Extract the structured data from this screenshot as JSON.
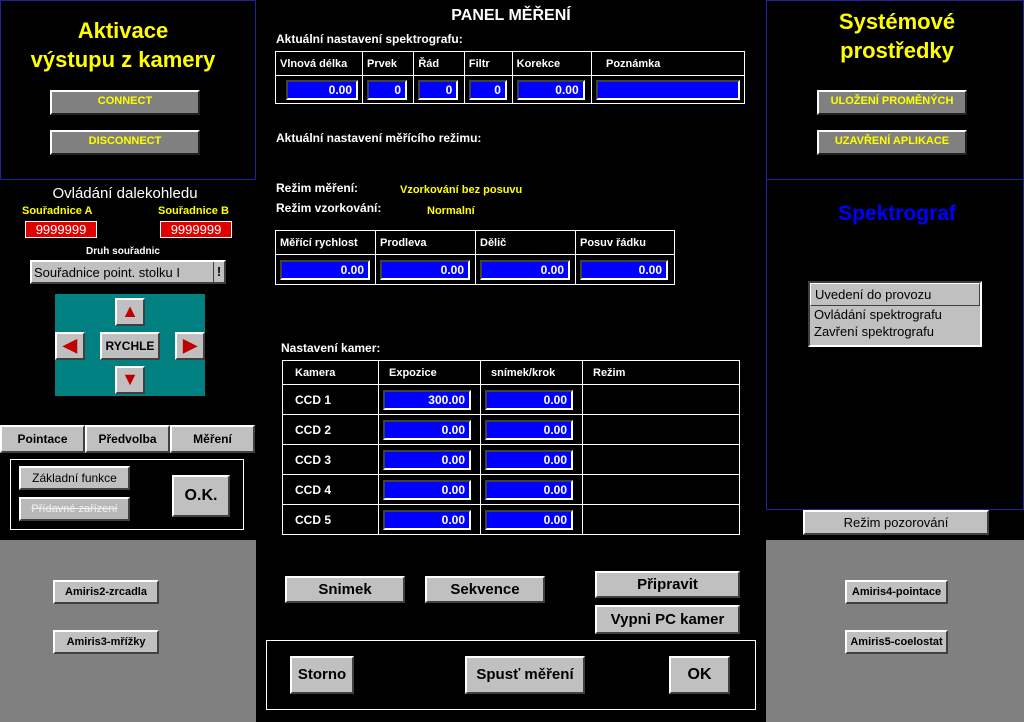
{
  "camera_activation": {
    "title_line1": "Aktivace",
    "title_line2": "výstupu z kamery",
    "connect": "CONNECT",
    "disconnect": "DISCONNECT"
  },
  "telescope": {
    "title": "Ovládání dalekohledu",
    "coord_a_label": "Souřadnice A",
    "coord_b_label": "Souřadnice B",
    "coord_a_value": "9999999",
    "coord_b_value": "9999999",
    "coord_type_label": "Druh souřadnic",
    "coord_type_value": "Souřadnice point. stolku I",
    "speed_label": "RYCHLE",
    "tabs": [
      "Pointace",
      "Předvolba",
      "Měření"
    ],
    "basic_functions": "Základní funkce",
    "extra_devices": "Přídavné zařízení",
    "ok": "O.K."
  },
  "panel": {
    "title": "PANEL MĚŘENÍ",
    "spectrograph_settings_label": "Aktuální nastavení spektrografu:",
    "spectro_headers": [
      "Vlnová délka",
      "Prvek",
      "Řád",
      "Filtr",
      "Korekce",
      "Poznámka"
    ],
    "spectro_values": [
      "0.00",
      "0",
      "0",
      "0",
      "0.00",
      ""
    ],
    "measure_mode_settings_label": "Aktuální nastavení měřícího režimu:",
    "measure_mode_label": "Režim měření:",
    "measure_mode_value": "Vzorkování bez posuvu",
    "sampling_mode_label": "Režim vzorkování:",
    "sampling_mode_value": "Normalní",
    "mode_headers": [
      "Měřící rychlost",
      "Prodleva",
      "Dělič",
      "Posuv řádku"
    ],
    "mode_values": [
      "0.00",
      "0.00",
      "0.00",
      "0.00"
    ],
    "camera_settings_label": "Nastavení kamer:",
    "camera_headers": [
      "Kamera",
      "Expozice",
      "snímek/krok",
      "Režim"
    ],
    "cameras": [
      {
        "name": "CCD 1",
        "exposure": "300.00",
        "frames": "0.00"
      },
      {
        "name": "CCD 2",
        "exposure": "0.00",
        "frames": "0.00"
      },
      {
        "name": "CCD 3",
        "exposure": "0.00",
        "frames": "0.00"
      },
      {
        "name": "CCD 4",
        "exposure": "0.00",
        "frames": "0.00"
      },
      {
        "name": "CCD 5",
        "exposure": "0.00",
        "frames": "0.00"
      }
    ],
    "snapshot": "Snimek",
    "sequence": "Sekvence",
    "prepare": "Připravit",
    "pc_off": "Vypni PC kamer",
    "cancel": "Storno",
    "start": "Spusť měření",
    "ok": "OK"
  },
  "system": {
    "title_line1": "Systémové",
    "title_line2": "prostředky",
    "save_vars": "ULOŽENÍ PROMĚNÝCH",
    "close_app": "UZAVŘENÍ APLIKACE"
  },
  "spectrograph": {
    "title": "Spektrograf",
    "menu": [
      "Uvedení do provozu",
      "Ovládání spektrografu",
      "Zavření spektrografu"
    ],
    "observation_mode": "Režim pozorování"
  },
  "amiris": {
    "left": [
      "Amiris2-zrcadla",
      "Amiris3-mřížky"
    ],
    "right": [
      "Amiris4-pointace",
      "Amiris5-coelostat"
    ]
  },
  "colors": {
    "accent_yellow": "#ffff00",
    "value_blue": "#0000ff",
    "teal": "#008080",
    "title_blue": "#0000ff"
  },
  "icons": [
    "arrow-up-icon",
    "arrow-down-icon",
    "arrow-left-icon",
    "arrow-right-icon"
  ]
}
